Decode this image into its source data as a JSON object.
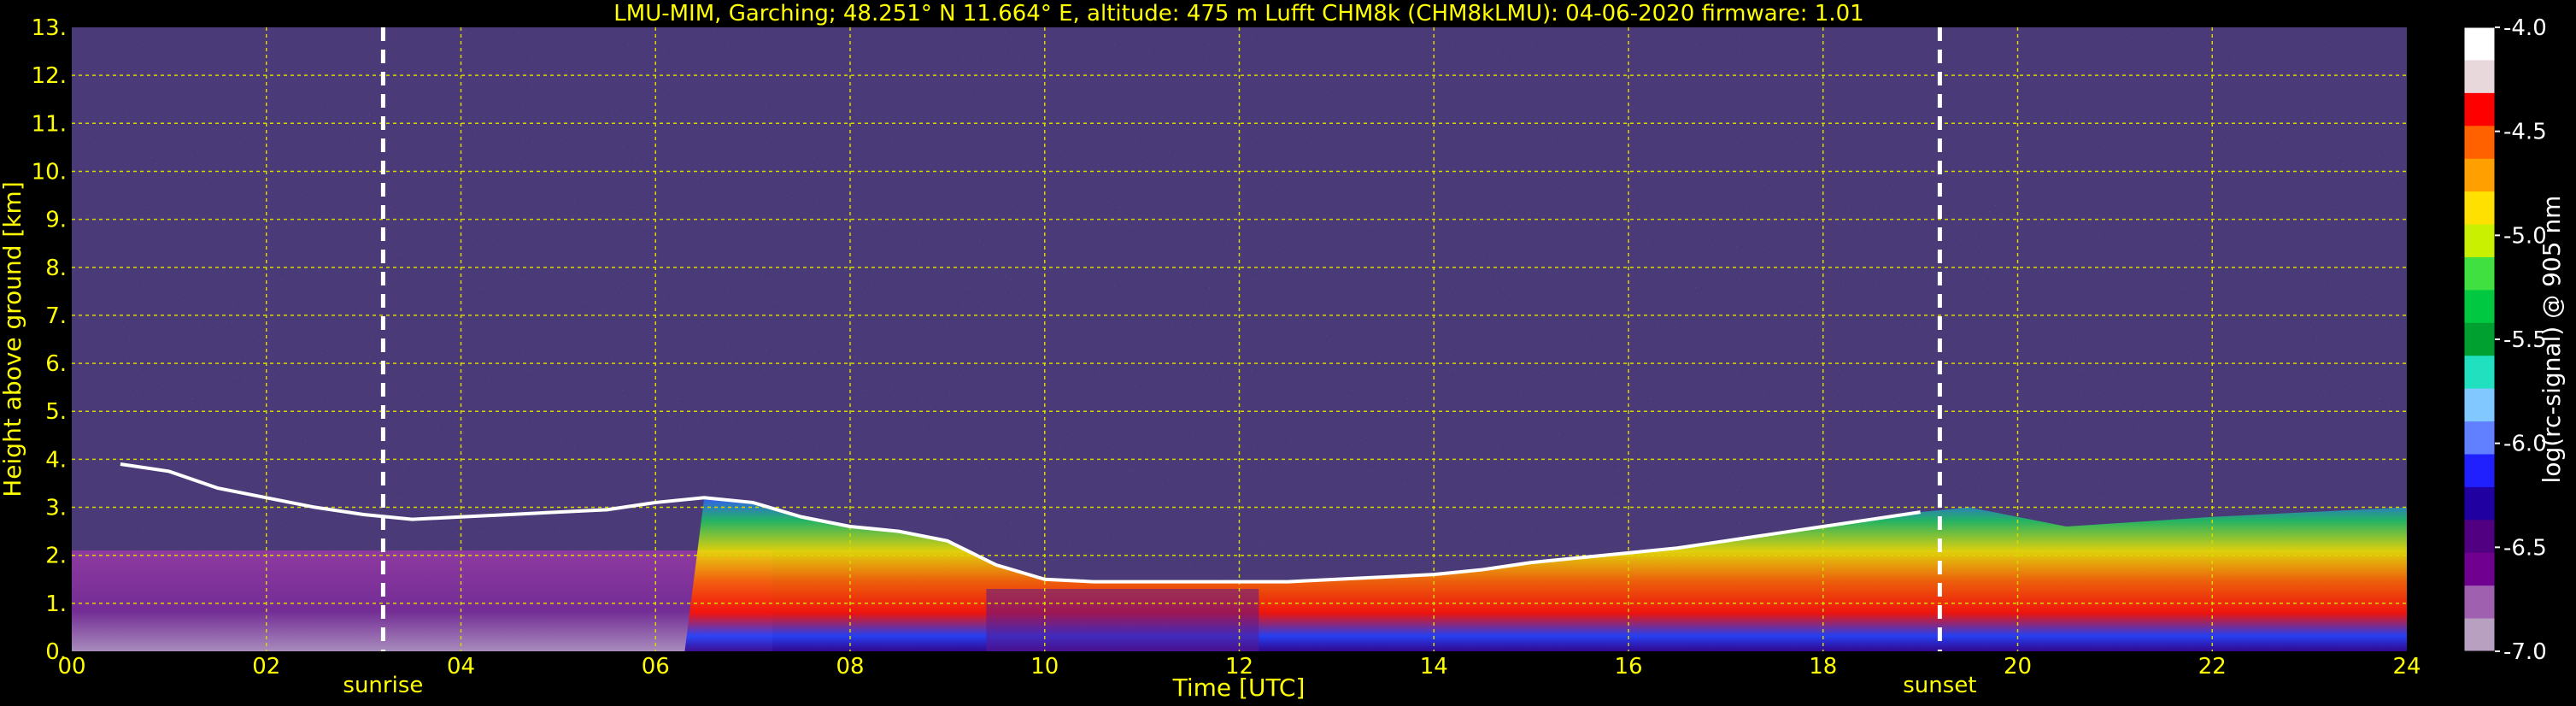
{
  "chart_data": {
    "type": "heatmap",
    "title": "LMU-MIM, Garching; 48.251° N 11.664° E, altitude: 475 m    Lufft CHM8k (CHM8kLMU): 04-06-2020    firmware: 1.01",
    "xlabel": "Time [UTC]",
    "ylabel": "Height above ground [km]",
    "xlim": [
      0,
      24
    ],
    "ylim": [
      0,
      13
    ],
    "x_ticks": [
      "00",
      "02",
      "04",
      "06",
      "08",
      "10",
      "12",
      "14",
      "16",
      "18",
      "20",
      "22",
      "24"
    ],
    "y_ticks": [
      "0.",
      "1.",
      "2.",
      "3.",
      "4.",
      "5.",
      "6.",
      "7.",
      "8.",
      "9.",
      "10.",
      "11.",
      "12.",
      "13."
    ],
    "grid": true,
    "annotations": [
      {
        "text": "sunrise",
        "x": 3.2
      },
      {
        "text": "sunset",
        "x": 19.2
      }
    ],
    "colorbar": {
      "label": "log(rc-signal) @ 905 nm",
      "range": [
        -7.0,
        -4.0
      ],
      "ticks": [
        "-4.0",
        "-4.5",
        "-5.0",
        "-5.5",
        "-6.0",
        "-6.5",
        "-7.0"
      ],
      "colors": [
        "#ffffff",
        "#e8d8dc",
        "#ff0000",
        "#ff6000",
        "#ffa000",
        "#ffe000",
        "#c8f000",
        "#40e040",
        "#00c840",
        "#00a030",
        "#20e0c0",
        "#80c8ff",
        "#6080ff",
        "#2020ff",
        "#2000a0",
        "#500080",
        "#700090",
        "#a060b0",
        "#b8a0c0"
      ]
    },
    "cloud_base_height": {
      "x": [
        0.5,
        1.0,
        1.5,
        2.0,
        2.5,
        3.0,
        3.5,
        4.0,
        4.5,
        5.0,
        5.5,
        6.0,
        6.5,
        7.0,
        7.5,
        8.0,
        8.5,
        9.0,
        9.5,
        10.0,
        10.5,
        11.0,
        11.5,
        12.0,
        12.5,
        13.0,
        13.5,
        14.0,
        14.5,
        15.0,
        15.5,
        16.0,
        16.5,
        17.0,
        17.5,
        18.0,
        18.5,
        19.0
      ],
      "y": [
        3.9,
        3.75,
        3.4,
        3.2,
        3.0,
        2.85,
        2.75,
        2.8,
        2.85,
        2.9,
        2.95,
        3.1,
        3.2,
        3.1,
        2.8,
        2.6,
        2.5,
        2.3,
        1.8,
        1.5,
        1.45,
        1.45,
        1.45,
        1.45,
        1.45,
        1.5,
        1.55,
        1.6,
        1.7,
        1.85,
        1.95,
        2.05,
        2.15,
        2.3,
        2.45,
        2.6,
        2.75,
        2.9
      ]
    }
  }
}
